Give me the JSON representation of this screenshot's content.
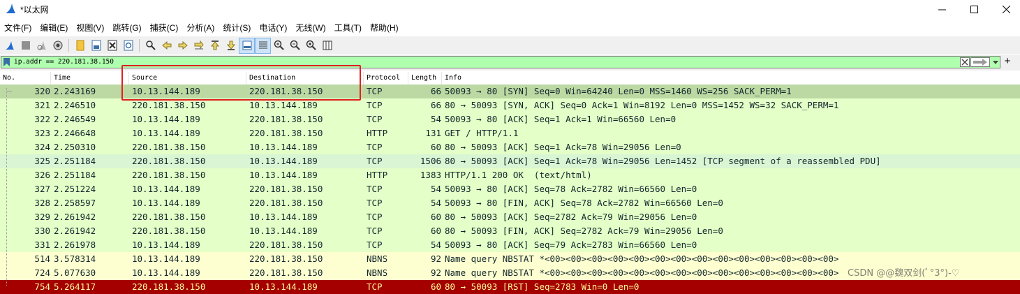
{
  "window": {
    "title": "*以太网",
    "app_icon": "shark-fin-icon"
  },
  "menu": [
    "文件(F)",
    "编辑(E)",
    "视图(V)",
    "跳转(G)",
    "捕获(C)",
    "分析(A)",
    "统计(S)",
    "电话(Y)",
    "无线(W)",
    "工具(T)",
    "帮助(H)"
  ],
  "toolbar": {
    "icons": [
      "start-capture-icon",
      "stop-capture-icon",
      "restart-capture-icon",
      "capture-options-icon",
      "open-file-icon",
      "save-file-icon",
      "close-file-icon",
      "reload-file-icon",
      "find-packet-icon",
      "go-back-icon",
      "go-forward-icon",
      "go-to-packet-icon",
      "go-first-packet-icon",
      "go-last-packet-icon",
      "auto-scroll-icon",
      "colorize-icon",
      "zoom-in-icon",
      "zoom-out-icon",
      "zoom-normal-icon",
      "resize-columns-icon"
    ]
  },
  "filter": {
    "value": "ip.addr == 220.181.38.150",
    "background": "#afffaf"
  },
  "columns": [
    "No.",
    "Time",
    "Source",
    "Destination",
    "Protocol",
    "Length",
    "Info"
  ],
  "packets": [
    {
      "no": "320",
      "time": "2.243169",
      "src": "10.13.144.189",
      "dst": "220.181.38.150",
      "proto": "TCP",
      "len": "66",
      "info": "50093 → 80 [SYN] Seq=0 Win=64240 Len=0 MSS=1460 WS=256 SACK_PERM=1",
      "bg": "#bcd9a3",
      "fg": "#12272e"
    },
    {
      "no": "321",
      "time": "2.246510",
      "src": "220.181.38.150",
      "dst": "10.13.144.189",
      "proto": "TCP",
      "len": "66",
      "info": "80 → 50093 [SYN, ACK] Seq=0 Ack=1 Win=8192 Len=0 MSS=1452 WS=32 SACK_PERM=1",
      "bg": "#e4ffc7",
      "fg": "#12272e"
    },
    {
      "no": "322",
      "time": "2.246549",
      "src": "10.13.144.189",
      "dst": "220.181.38.150",
      "proto": "TCP",
      "len": "54",
      "info": "50093 → 80 [ACK] Seq=1 Ack=1 Win=66560 Len=0",
      "bg": "#e4ffc7",
      "fg": "#12272e"
    },
    {
      "no": "323",
      "time": "2.246648",
      "src": "10.13.144.189",
      "dst": "220.181.38.150",
      "proto": "HTTP",
      "len": "131",
      "info": "GET / HTTP/1.1",
      "bg": "#e4ffc7",
      "fg": "#12272e"
    },
    {
      "no": "324",
      "time": "2.250310",
      "src": "220.181.38.150",
      "dst": "10.13.144.189",
      "proto": "TCP",
      "len": "60",
      "info": "80 → 50093 [ACK] Seq=1 Ack=78 Win=29056 Len=0",
      "bg": "#e4ffc7",
      "fg": "#12272e"
    },
    {
      "no": "325",
      "time": "2.251184",
      "src": "220.181.38.150",
      "dst": "10.13.144.189",
      "proto": "TCP",
      "len": "1506",
      "info": "80 → 50093 [ACK] Seq=1 Ack=78 Win=29056 Len=1452 [TCP segment of a reassembled PDU]",
      "bg": "#d9f5d3",
      "fg": "#12272e"
    },
    {
      "no": "326",
      "time": "2.251184",
      "src": "220.181.38.150",
      "dst": "10.13.144.189",
      "proto": "HTTP",
      "len": "1383",
      "info": "HTTP/1.1 200 OK  (text/html)",
      "bg": "#e4ffc7",
      "fg": "#12272e"
    },
    {
      "no": "327",
      "time": "2.251224",
      "src": "10.13.144.189",
      "dst": "220.181.38.150",
      "proto": "TCP",
      "len": "54",
      "info": "50093 → 80 [ACK] Seq=78 Ack=2782 Win=66560 Len=0",
      "bg": "#e4ffc7",
      "fg": "#12272e"
    },
    {
      "no": "328",
      "time": "2.258597",
      "src": "10.13.144.189",
      "dst": "220.181.38.150",
      "proto": "TCP",
      "len": "54",
      "info": "50093 → 80 [FIN, ACK] Seq=78 Ack=2782 Win=66560 Len=0",
      "bg": "#e4ffc7",
      "fg": "#12272e"
    },
    {
      "no": "329",
      "time": "2.261942",
      "src": "220.181.38.150",
      "dst": "10.13.144.189",
      "proto": "TCP",
      "len": "60",
      "info": "80 → 50093 [ACK] Seq=2782 Ack=79 Win=29056 Len=0",
      "bg": "#e4ffc7",
      "fg": "#12272e"
    },
    {
      "no": "330",
      "time": "2.261942",
      "src": "220.181.38.150",
      "dst": "10.13.144.189",
      "proto": "TCP",
      "len": "60",
      "info": "80 → 50093 [FIN, ACK] Seq=2782 Ack=79 Win=29056 Len=0",
      "bg": "#e4ffc7",
      "fg": "#12272e"
    },
    {
      "no": "331",
      "time": "2.261978",
      "src": "10.13.144.189",
      "dst": "220.181.38.150",
      "proto": "TCP",
      "len": "54",
      "info": "50093 → 80 [ACK] Seq=79 Ack=2783 Win=66560 Len=0",
      "bg": "#e4ffc7",
      "fg": "#12272e"
    },
    {
      "no": "514",
      "time": "3.578314",
      "src": "10.13.144.189",
      "dst": "220.181.38.150",
      "proto": "NBNS",
      "len": "92",
      "info": "Name query NBSTAT *<00><00><00><00><00><00><00><00><00><00><00><00><00><00>",
      "bg": "#feffd0",
      "fg": "#12272e"
    },
    {
      "no": "724",
      "time": "5.077630",
      "src": "10.13.144.189",
      "dst": "220.181.38.150",
      "proto": "NBNS",
      "len": "92",
      "info": "Name query NBSTAT *<00><00><00><00><00><00><00><00><00><00><00><00><00><00>",
      "bg": "#feffd0",
      "fg": "#12272e"
    },
    {
      "no": "754",
      "time": "5.264117",
      "src": "220.181.38.150",
      "dst": "10.13.144.189",
      "proto": "TCP",
      "len": "60",
      "info": "80 → 50093 [RST] Seq=2783 Win=0 Len=0",
      "bg": "#a40000",
      "fg": "#fffc9c"
    }
  ],
  "watermark": "CSDN @@魏双剑(ﾟ°3°)-♡",
  "colors": {
    "highlight_box": "#e02020",
    "selected_row": "#bcd9a3"
  }
}
